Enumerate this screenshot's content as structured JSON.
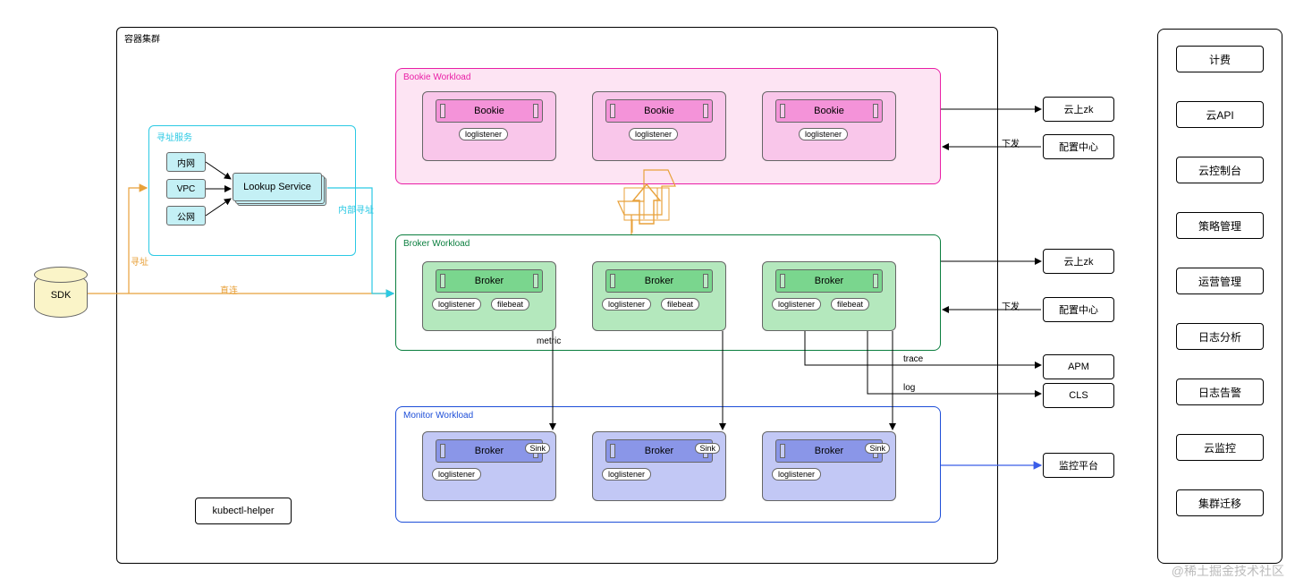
{
  "sdk": "SDK",
  "containerCluster": "容器集群",
  "lookupService": {
    "title": "寻址服务",
    "intranet": "内网",
    "vpc": "VPC",
    "public": "公网",
    "service": "Lookup Service",
    "internalAddr": "内部寻址"
  },
  "bookieWorkload": {
    "title": "Bookie Workload",
    "pod": "Bookie",
    "loglistener": "loglistener"
  },
  "brokerWorkload": {
    "title": "Broker Workload",
    "pod": "Broker",
    "loglistener": "loglistener",
    "filebeat": "filebeat"
  },
  "monitorWorkload": {
    "title": "Monitor Workload",
    "pod": "Broker",
    "sink": "Sink",
    "loglistener": "loglistener"
  },
  "kubectlHelper": "kubectl-helper",
  "labels": {
    "addr": "寻址",
    "direct": "直连",
    "metric": "metric",
    "trace": "trace",
    "log": "log",
    "deliver": "下发"
  },
  "right": {
    "cloudZk": "云上zk",
    "configCenter": "配置中心",
    "apm": "APM",
    "cls": "CLS",
    "monitorPlatform": "监控平台"
  },
  "panel": [
    "计费",
    "云API",
    "云控制台",
    "策略管理",
    "运营管理",
    "日志分析",
    "日志告警",
    "云监控",
    "集群迁移"
  ],
  "watermark": "@稀土掘金技术社区"
}
